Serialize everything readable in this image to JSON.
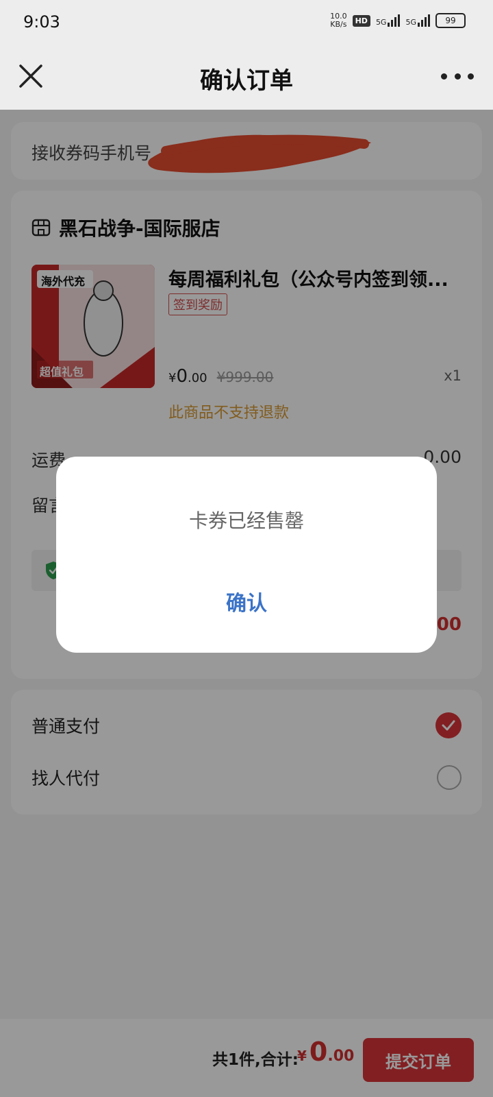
{
  "status_bar": {
    "time": "9:03",
    "net_speed_value": "10.0",
    "net_speed_unit": "KB/s",
    "hd_badge": "HD",
    "signal1": "5G",
    "signal2": "5G",
    "battery": "99"
  },
  "header": {
    "title": "确认订单",
    "close_icon": "close-icon",
    "more_icon": "more-icon"
  },
  "phone_section": {
    "label": "接收券码手机号"
  },
  "order": {
    "shop_name": "黑石战争-国际服店",
    "product": {
      "title": "每周福利礼包（公众号内签到领...",
      "tag": "签到奖励",
      "price_currency": "¥",
      "price_int": "0",
      "price_dec": ".00",
      "original_price": "¥999.00",
      "quantity": "x1",
      "refund_notice": "此商品不支持退款",
      "image_text_top": "海外代充",
      "image_text_bottom": "超值礼包"
    },
    "shipping_label": "运费",
    "shipping_value": "0.00",
    "note_label": "留言",
    "subtotal_value": "0.00"
  },
  "payment": {
    "options": [
      {
        "label": "普通支付",
        "selected": true
      },
      {
        "label": "找人代付",
        "selected": false
      }
    ]
  },
  "bottom_bar": {
    "count_total_label": "共1件,合计:",
    "currency": "¥",
    "amount_int": "0",
    "amount_dec": ".00",
    "submit_label": "提交订单"
  },
  "dialog": {
    "message": "卡券已经售罄",
    "confirm_label": "确认"
  },
  "colors": {
    "accent_red": "#d9353a",
    "dialog_link_blue": "#3b73c7",
    "refund_orange": "#d89a32"
  }
}
